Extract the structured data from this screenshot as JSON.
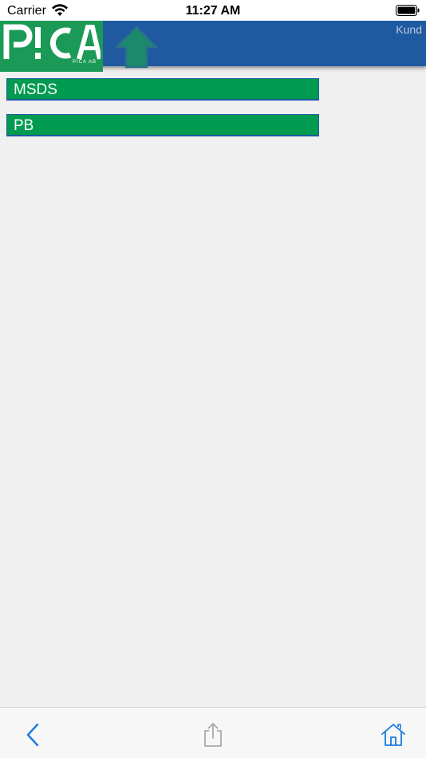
{
  "status_bar": {
    "carrier": "Carrier",
    "time": "11:27 AM"
  },
  "header": {
    "logo_text": "P!CA",
    "logo_subtext": "PICA AB",
    "title": "Kund"
  },
  "list": {
    "items": [
      {
        "label": "MSDS"
      },
      {
        "label": "PB"
      }
    ]
  },
  "toolbar": {
    "back_icon": "chevron-left-icon",
    "share_icon": "share-icon",
    "home_icon": "home-icon"
  },
  "colors": {
    "header_blue": "#1f5aa0",
    "logo_green": "#1a9a56",
    "item_green": "#009b50",
    "toolbar_tint": "#1a7ae0"
  }
}
